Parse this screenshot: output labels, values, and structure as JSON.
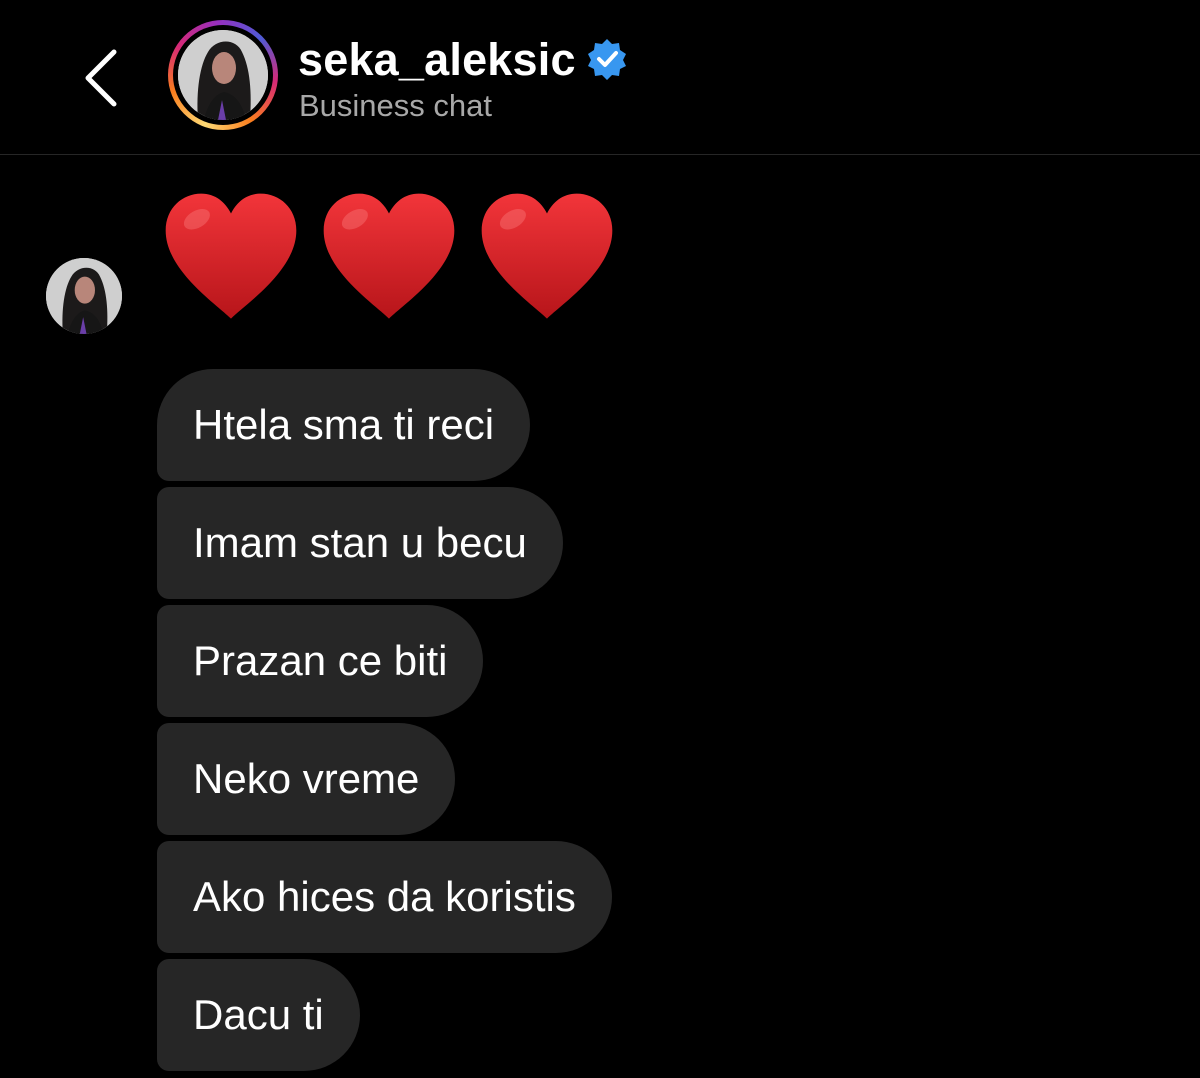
{
  "header": {
    "username": "seka_aleksic",
    "subtitle": "Business chat",
    "verified": true,
    "back_icon": "chevron-left-icon",
    "verified_icon": "verified-badge-icon",
    "verified_color": "#3897f0"
  },
  "messages": [
    {
      "type": "emoji",
      "text": "❤️❤️❤️",
      "icon": "red-heart-icon",
      "count": 3,
      "color": "#d61a1f"
    },
    {
      "type": "text",
      "text": "Htela sma ti reci"
    },
    {
      "type": "text",
      "text": "Imam stan u becu"
    },
    {
      "type": "text",
      "text": "Prazan ce biti"
    },
    {
      "type": "text",
      "text": "Neko vreme"
    },
    {
      "type": "text",
      "text": "Ako hices da koristis"
    },
    {
      "type": "text",
      "text": "Dacu ti"
    }
  ],
  "colors": {
    "background": "#000000",
    "bubble": "#262626",
    "text": "#ffffff",
    "subtitle": "#a8a8a8"
  }
}
